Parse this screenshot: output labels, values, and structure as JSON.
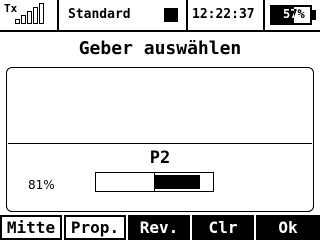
{
  "status": {
    "tx_label": "Tx",
    "profile": "Standard",
    "clock": "12:22:37",
    "battery_text": "57%",
    "battery_level": 0.57
  },
  "title": "Geber auswählen",
  "control": {
    "name": "P2",
    "percent_text": "81%",
    "gauge_value": 0.81
  },
  "softkeys": [
    {
      "label": "Mitte"
    },
    {
      "label": "Prop."
    },
    {
      "label": "Rev."
    },
    {
      "label": "Clr"
    },
    {
      "label": "Ok"
    }
  ]
}
